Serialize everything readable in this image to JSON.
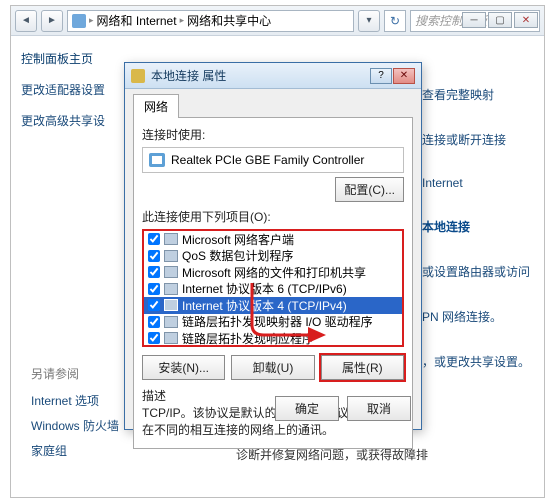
{
  "cp": {
    "breadcrumb": {
      "seg1": "网络和 Internet",
      "seg2": "网络和共享中心"
    },
    "search_placeholder": "搜索控制面板",
    "side_title": "控制面板主页",
    "side_links": [
      "更改适配器设置",
      "更改高级共享设"
    ],
    "right_links": [
      {
        "label": "查看完整映射",
        "strong": false
      },
      {
        "label": "连接或断开连接",
        "strong": false
      },
      {
        "label": "Internet",
        "strong": false
      },
      {
        "label": "本地连接",
        "strong": true
      },
      {
        "label": "或设置路由器或访问",
        "strong": false
      },
      {
        "label": "PN 网络连接。",
        "strong": false
      },
      {
        "label": "，或更改共享设置。",
        "strong": false
      }
    ],
    "lower_title": "另请参阅",
    "lower_links": [
      "Internet 选项",
      "Windows 防火墙",
      "家庭组"
    ],
    "bottom_text": "诊断并修复网络问题，或获得故障排"
  },
  "dialog": {
    "title": "本地连接 属性",
    "tab": "网络",
    "connect_using_label": "连接时使用:",
    "adapter": "Realtek PCIe GBE Family Controller",
    "configure_btn": "配置(C)...",
    "items_label": "此连接使用下列项目(O):",
    "items": [
      {
        "label": "Microsoft 网络客户端",
        "checked": true
      },
      {
        "label": "QoS 数据包计划程序",
        "checked": true
      },
      {
        "label": "Microsoft 网络的文件和打印机共享",
        "checked": true
      },
      {
        "label": "Internet 协议版本 6 (TCP/IPv6)",
        "checked": true
      },
      {
        "label": "Internet 协议版本 4 (TCP/IPv4)",
        "checked": true,
        "selected": true
      },
      {
        "label": "链路层拓扑发现映射器 I/O 驱动程序",
        "checked": true
      },
      {
        "label": "链路层拓扑发现响应程序",
        "checked": true
      }
    ],
    "install_btn": "安装(N)...",
    "uninstall_btn": "卸载(U)",
    "properties_btn": "属性(R)",
    "desc_title": "描述",
    "desc_text": "TCP/IP。该协议是默认的广域网络协议，它提供在不同的相互连接的网络上的通讯。",
    "ok": "确定",
    "cancel": "取消"
  }
}
